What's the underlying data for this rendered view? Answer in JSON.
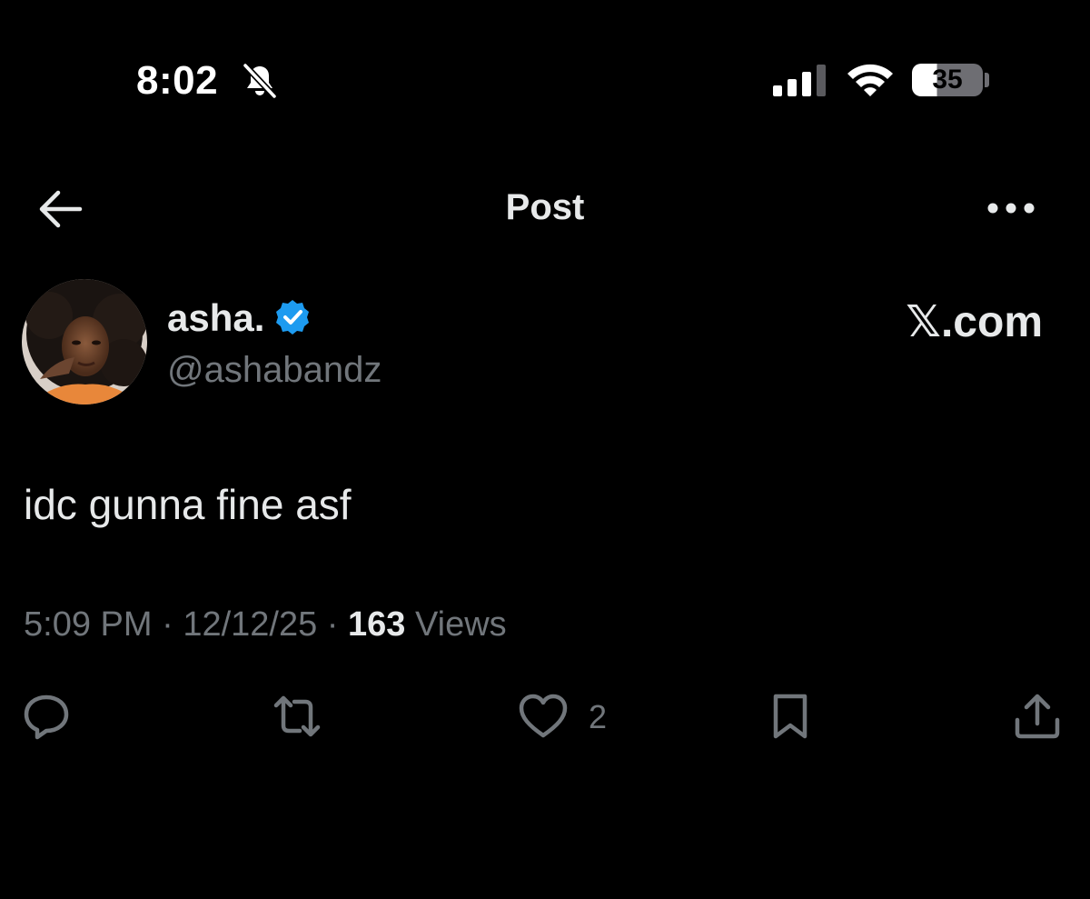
{
  "status_bar": {
    "time": "8:02",
    "silent_icon": "bell-slash-icon",
    "signal_icon": "cellular-signal-icon",
    "wifi_icon": "wifi-icon",
    "battery_level": "35",
    "battery_fraction": 0.35
  },
  "header": {
    "back_icon": "arrow-left-icon",
    "title": "Post",
    "more_icon": "ellipsis-icon"
  },
  "author": {
    "display_name": "asha.",
    "verified_icon": "verified-badge-icon",
    "verified_color": "#1d9bf0",
    "handle": "@ashabandz"
  },
  "watermark": "𝕏.com",
  "post": {
    "text": "idc gunna fine asf",
    "time": "5:09 PM",
    "separator": "·",
    "date": "12/12/25",
    "views_count": "163",
    "views_label": "Views"
  },
  "actions": {
    "reply_icon": "comment-icon",
    "retweet_icon": "repost-icon",
    "like_icon": "heart-icon",
    "like_count": "2",
    "bookmark_icon": "bookmark-icon",
    "share_icon": "share-icon"
  },
  "colors": {
    "background": "#000000",
    "primary_text": "#e7e9ea",
    "secondary_text": "#71767b",
    "accent": "#1d9bf0"
  }
}
